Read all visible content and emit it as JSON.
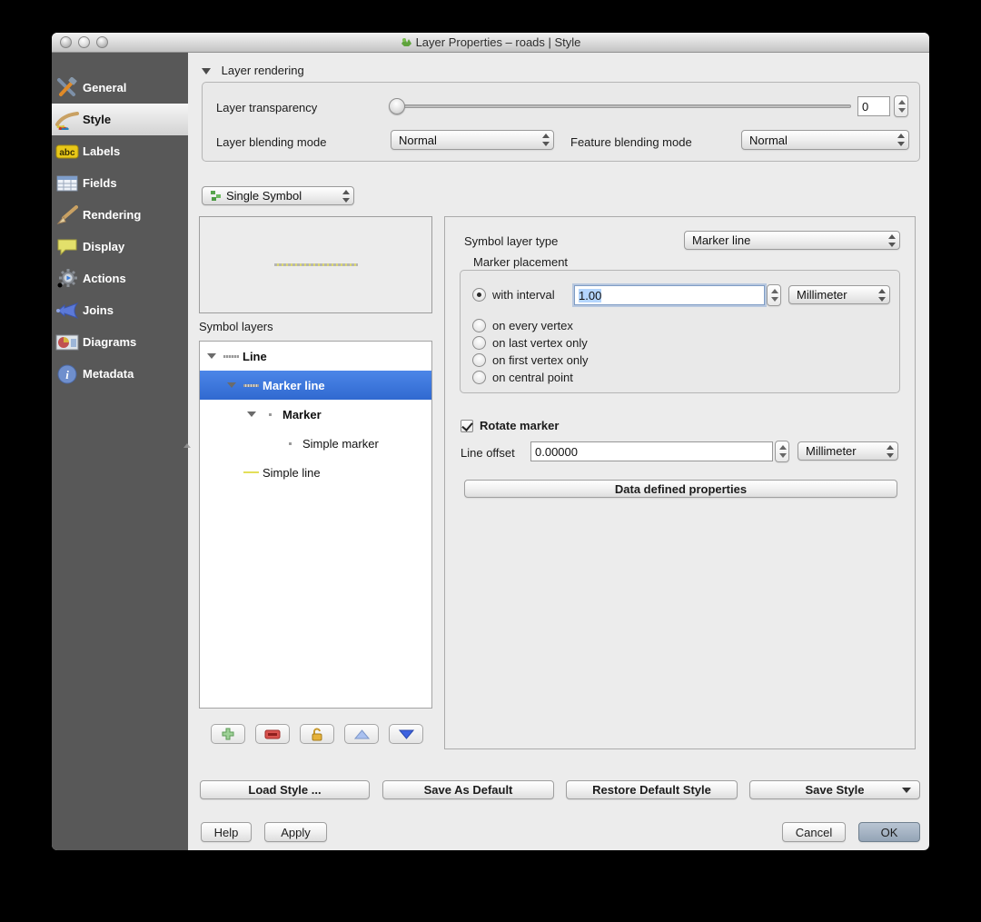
{
  "window": {
    "title": "Layer Properties – roads | Style"
  },
  "sidebar": {
    "items": [
      {
        "label": "General",
        "icon": "hammer-wrench"
      },
      {
        "label": "Style",
        "icon": "style-brush",
        "selected": true
      },
      {
        "label": "Labels",
        "icon": "abc-tag"
      },
      {
        "label": "Fields",
        "icon": "table"
      },
      {
        "label": "Rendering",
        "icon": "render-brush"
      },
      {
        "label": "Display",
        "icon": "speech-bubble"
      },
      {
        "label": "Actions",
        "icon": "gear-play"
      },
      {
        "label": "Joins",
        "icon": "join-arrow"
      },
      {
        "label": "Diagrams",
        "icon": "diagram"
      },
      {
        "label": "Metadata",
        "icon": "info"
      }
    ]
  },
  "layer_rendering": {
    "header": "Layer rendering",
    "transparency_label": "Layer transparency",
    "transparency_value": "0",
    "layer_blending_label": "Layer blending mode",
    "layer_blending_value": "Normal",
    "feature_blending_label": "Feature blending mode",
    "feature_blending_value": "Normal"
  },
  "renderer": {
    "value": "Single Symbol"
  },
  "symbol_layers": {
    "label": "Symbol layers",
    "tree": [
      {
        "label": "Line",
        "depth": 0,
        "bold": true,
        "expandable": true,
        "icon": "dash",
        "selected": false
      },
      {
        "label": "Marker line",
        "depth": 1,
        "bold": true,
        "expandable": true,
        "icon": "dash",
        "selected": true
      },
      {
        "label": "Marker",
        "depth": 2,
        "bold": true,
        "expandable": true,
        "icon": "dot",
        "selected": false
      },
      {
        "label": "Simple marker",
        "depth": 3,
        "bold": false,
        "expandable": false,
        "icon": "dot",
        "selected": false
      },
      {
        "label": "Simple line",
        "depth": 1,
        "bold": false,
        "expandable": false,
        "icon": "yellow",
        "selected": false
      }
    ]
  },
  "properties": {
    "symbol_layer_type_label": "Symbol layer type",
    "symbol_layer_type_value": "Marker line",
    "marker_placement_label": "Marker placement",
    "with_interval_label": "with interval",
    "interval_value": "1.00",
    "interval_unit": "Millimeter",
    "radio_options": [
      "on every vertex",
      "on last vertex only",
      "on first vertex only",
      "on central point"
    ],
    "rotate_marker_label": "Rotate marker",
    "line_offset_label": "Line offset",
    "line_offset_value": "0.00000",
    "line_offset_unit": "Millimeter",
    "data_defined_button": "Data defined properties"
  },
  "style_buttons": {
    "load": "Load Style ...",
    "save_default": "Save As Default",
    "restore": "Restore Default Style",
    "save_style": "Save Style"
  },
  "action_buttons": {
    "help": "Help",
    "apply": "Apply",
    "cancel": "Cancel",
    "ok": "OK"
  },
  "colors": {
    "selection": "#3a74d6",
    "sidebar": "#585858",
    "accent_green": "#61b854"
  }
}
